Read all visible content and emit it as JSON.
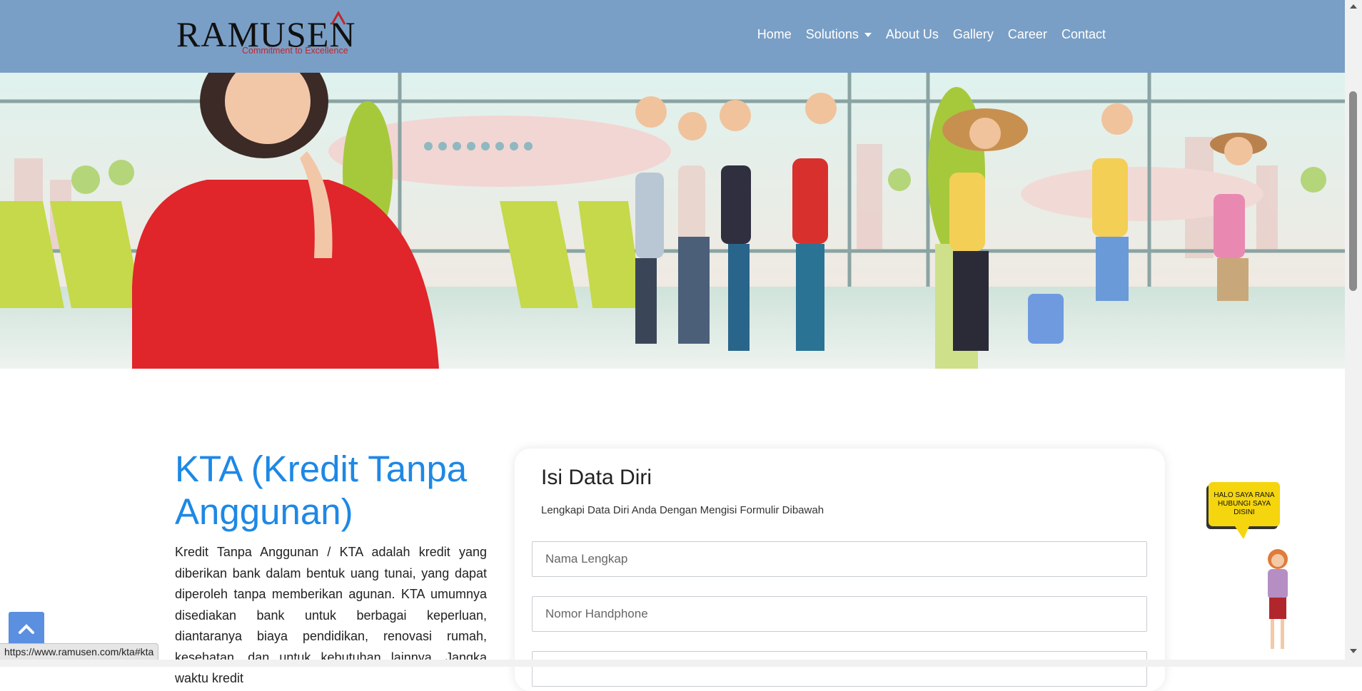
{
  "brand": {
    "name": "RAMUSEN",
    "tagline": "Commitment to Excellence"
  },
  "nav": {
    "items": [
      {
        "label": "Home"
      },
      {
        "label": "Solutions",
        "dropdown": true
      },
      {
        "label": "About Us"
      },
      {
        "label": "Gallery"
      },
      {
        "label": "Career"
      },
      {
        "label": "Contact"
      }
    ]
  },
  "main": {
    "title": "KTA (Kredit Tanpa Anggunan)",
    "description": "Kredit Tanpa Anggunan / KTA adalah kredit yang diberikan bank dalam bentuk uang tunai, yang dapat diperoleh tanpa memberikan agunan. KTA umumnya disediakan bank untuk berbagai keperluan, diantaranya biaya pendidikan, renovasi rumah, kesehatan, dan untuk kebutuhan lainnya. Jangka waktu kredit"
  },
  "form": {
    "title": "Isi Data Diri",
    "subtitle": "Lengkapi Data Diri Anda Dengan Mengisi Formulir Dibawah",
    "fields": [
      {
        "placeholder": "Nama Lengkap",
        "value": ""
      },
      {
        "placeholder": "Nomor Handphone",
        "value": ""
      },
      {
        "placeholder": "",
        "value": ""
      }
    ]
  },
  "chat_widget": {
    "bubble_text": "HALO SAYA RANA HUBUNGI SAYA DISINI"
  },
  "status_bar": {
    "url": "https://www.ramusen.com/kta#kta"
  },
  "colors": {
    "navbar": "#7a9fc6",
    "accent_title": "#1e88e5",
    "brand_red": "#c0262c",
    "bubble": "#f5d50e",
    "scroll_top": "#5b8fe0"
  },
  "icons": {
    "scroll_top": "chevron-up-icon",
    "dropdown": "caret-down-icon"
  }
}
